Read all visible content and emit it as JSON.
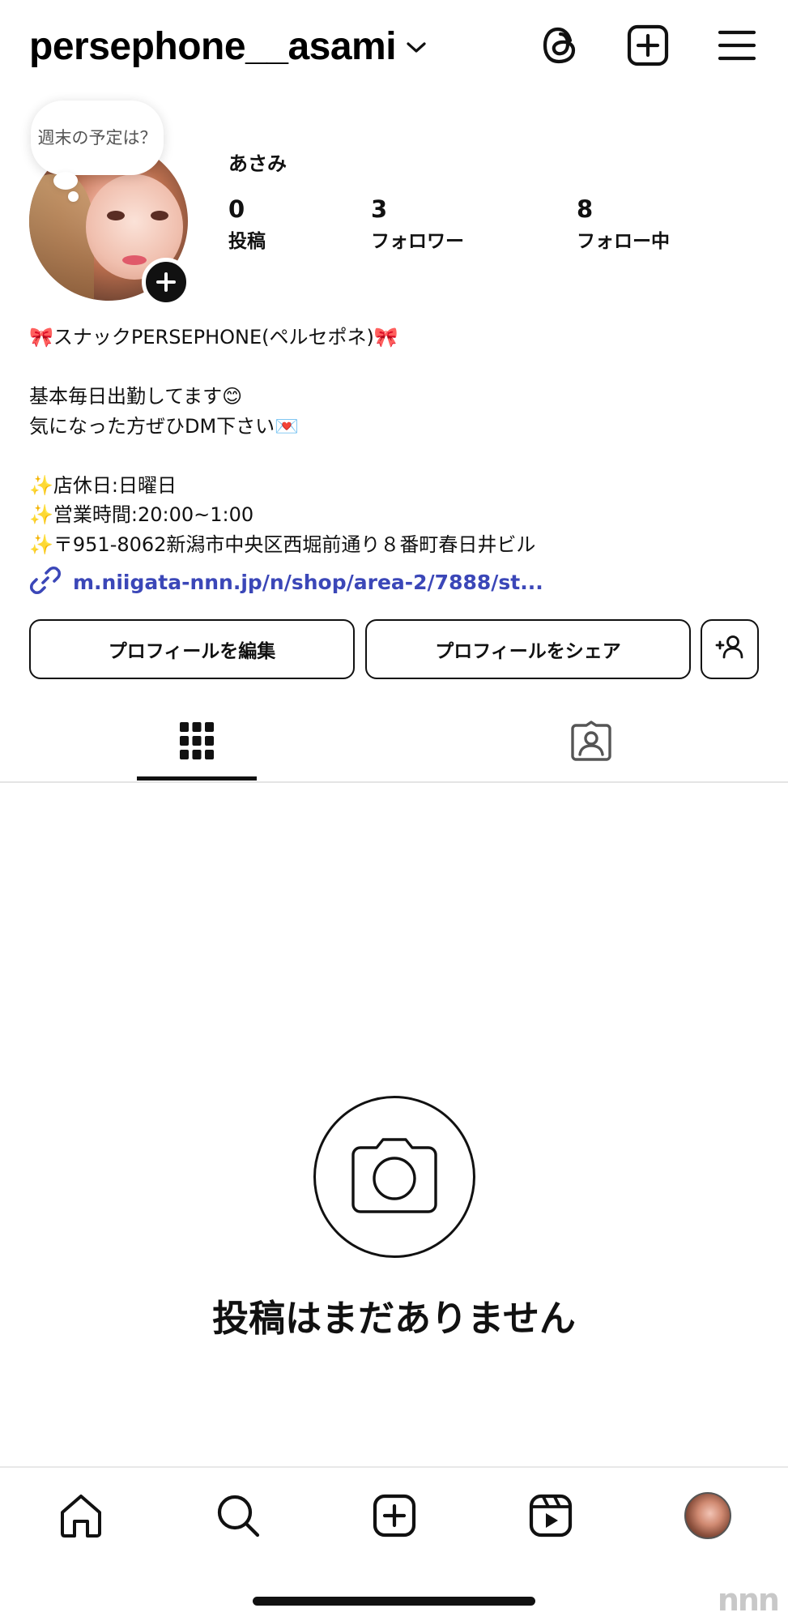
{
  "header": {
    "username": "persephone__asami",
    "icons": [
      "chevron-down-icon",
      "threads-icon",
      "plus-square-icon",
      "hamburger-menu-icon"
    ]
  },
  "profile": {
    "note": "週末の予定は？",
    "display_name": "あさみ",
    "stats": [
      {
        "value": "0",
        "label": "投稿"
      },
      {
        "value": "3",
        "label": "フォロワー"
      },
      {
        "value": "8",
        "label": "フォロー中"
      }
    ]
  },
  "bio": {
    "lines": [
      "🎀スナックPERSEPHONE(ペルセポネ)🎀",
      "",
      "基本毎日出勤してます😊",
      "気になった方ぜひDM下さい💌",
      "",
      "✨店休日:日曜日",
      "✨営業時間:20:00~1:00",
      "✨〒951-8062新潟市中央区西堀前通り８番町春日井ビル"
    ],
    "link": "m.niigata-nnn.jp/n/shop/area-2/7888/st..."
  },
  "buttons": {
    "edit": "プロフィールを編集",
    "share": "プロフィールをシェア"
  },
  "tabs": [
    "grid-icon",
    "tagged-icon"
  ],
  "empty_state": {
    "text": "投稿はまだありません"
  },
  "bottom_nav": [
    "home-icon",
    "search-icon",
    "create-icon",
    "reels-icon",
    "profile-avatar"
  ],
  "watermark": "nnn",
  "colors": {
    "link": "#3b47b8",
    "text": "#111111",
    "background": "#ffffff"
  }
}
